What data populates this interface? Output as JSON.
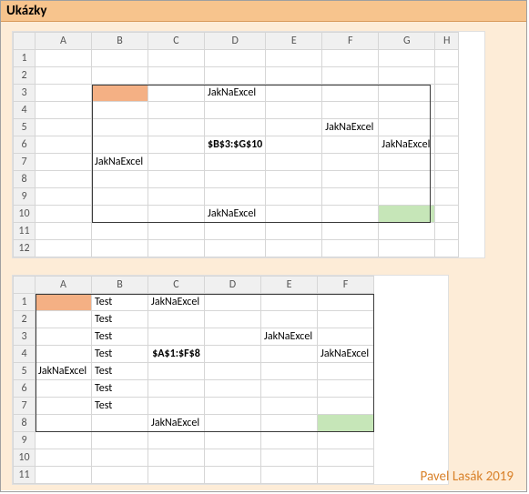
{
  "title": "Ukázky",
  "footer": "Pavel Lasák 2019",
  "sheet1": {
    "cols": [
      "A",
      "B",
      "C",
      "D",
      "E",
      "F",
      "G",
      "H"
    ],
    "rows": [
      "1",
      "2",
      "3",
      "4",
      "5",
      "6",
      "7",
      "8",
      "9",
      "10",
      "11",
      "12"
    ],
    "range_label": "$B$3:$G$10",
    "cells": {
      "D3": "JakNaExcel",
      "F5": "JakNaExcel",
      "G6": "JakNaExcel",
      "B7": "JakNaExcel",
      "D10": "JakNaExcel"
    }
  },
  "sheet2": {
    "cols": [
      "A",
      "B",
      "C",
      "D",
      "E",
      "F"
    ],
    "rows": [
      "1",
      "2",
      "3",
      "4",
      "5",
      "6",
      "7",
      "8",
      "9",
      "10",
      "11"
    ],
    "range_label": "$A$1:$F$8",
    "cells": {
      "B1": "Test",
      "C1": "JakNaExcel",
      "B2": "Test",
      "B3": "Test",
      "E3": "JakNaExcel",
      "B4": "Test",
      "F4": "JakNaExcel",
      "A5": "JakNaExcel",
      "B5": "Test",
      "B6": "Test",
      "B7": "Test",
      "C8": "JakNaExcel"
    }
  }
}
